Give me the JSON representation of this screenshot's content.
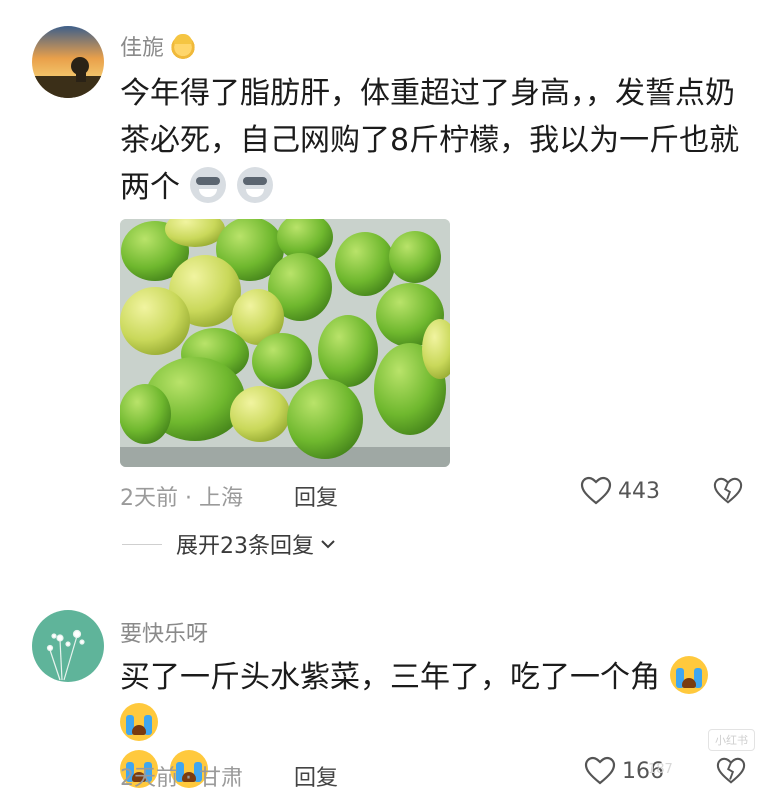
{
  "comments": [
    {
      "username": "佳旎",
      "text_lines": [
        "今年得了脂肪肝，体重超过了身高，，发誓点奶",
        "茶必死，自己网购了8斤柠檬，我以为一斤也就",
        "两个"
      ],
      "trailing_emojis": [
        "wolf-emoji",
        "wolf-emoji"
      ],
      "has_photo": true,
      "time_location": "2天前 · 上海",
      "reply_label": "回复",
      "likes": "443",
      "expand_replies": "展开23条回复"
    },
    {
      "username": "要快乐呀",
      "text_lines": [
        "买了一斤头水紫菜，三年了，吃了一个角"
      ],
      "trailing_emojis": [
        "crying-emoji",
        "crying-emoji",
        "crying-emoji",
        "crying-emoji"
      ],
      "has_photo": false,
      "time_location": "2天前 · 甘肃",
      "reply_label": "回复",
      "likes": "166"
    }
  ],
  "watermark": {
    "brand": "小红书",
    "user_id": "187"
  },
  "colors": {
    "text": "#1b1b1b",
    "meta": "#9a9a9a",
    "lemon_green": "#7cc63a",
    "lemon_yellow": "#d8e56a"
  }
}
